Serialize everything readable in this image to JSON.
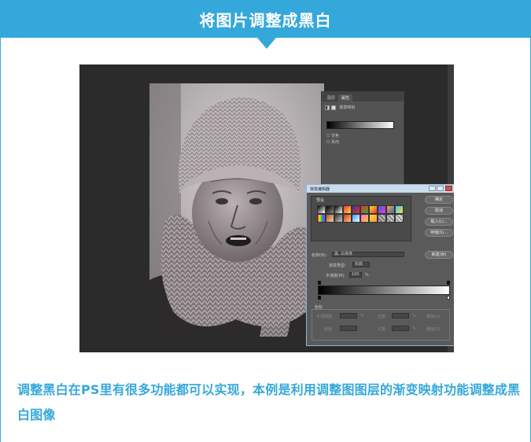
{
  "header": {
    "title": "将图片调整成黑白"
  },
  "properties_panel": {
    "tabs": [
      "图层",
      "属性"
    ],
    "row_label": "渐变映射",
    "checkboxes": [
      "仿色",
      "反向"
    ]
  },
  "gradient_editor": {
    "title": "渐变编辑器",
    "presets_label": "预设",
    "buttons": [
      "确定",
      "取消",
      "载入(L)...",
      "存储(S)...",
      "新建(W)"
    ],
    "name_label": "名称(N):",
    "name_value": "黑, 白渐变",
    "type_label": "渐变类型:",
    "type_value": "实底",
    "smooth_label": "平滑度(M):",
    "smooth_value": "100",
    "smooth_unit": "%",
    "stops_label": "色标",
    "opacity_label": "不透明度:",
    "color_label": "颜色:",
    "location_label": "位置:",
    "delete_label": "删除(D)",
    "percent": "%"
  },
  "description": "调整黑白在PS里有很多功能都可以实现，本例是利用调整图图层的渐变映射功能调整成黑白图像"
}
